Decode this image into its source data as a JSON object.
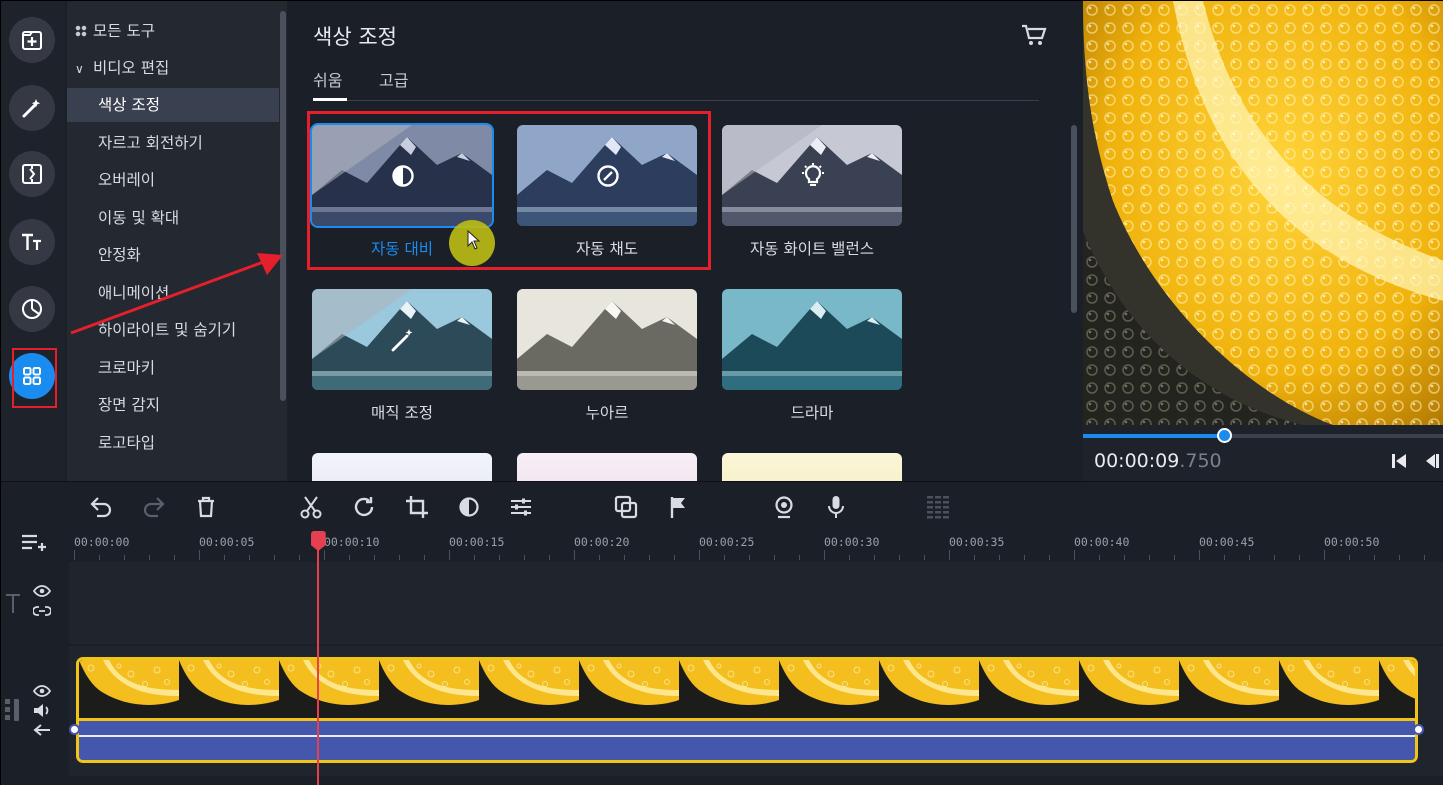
{
  "categories": {
    "all_tools": "모든 도구",
    "video_editing": "비디오 편집",
    "items": [
      "색상 조정",
      "자르고 회전하기",
      "오버레이",
      "이동 및 확대",
      "안정화",
      "애니메이션",
      "하이라이트 및 숨기기",
      "크로마키",
      "장면 감지",
      "로고타입"
    ],
    "selected_index": 0
  },
  "panel": {
    "title": "색상 조정",
    "tabs": [
      "쉬움",
      "고급"
    ],
    "active_tab": 0,
    "tiles": [
      {
        "label": "자동 대비",
        "icon": "contrast-icon",
        "selected": true
      },
      {
        "label": "자동 채도",
        "icon": "gauge-icon",
        "selected": false
      },
      {
        "label": "자동 화이트 밸런스",
        "icon": "lightbulb-icon",
        "selected": false
      },
      {
        "label": "매직 조정",
        "icon": "magic-wand-icon",
        "selected": false
      },
      {
        "label": "누아르",
        "icon": "",
        "selected": false
      },
      {
        "label": "드라마",
        "icon": "",
        "selected": false
      }
    ]
  },
  "preview": {
    "time_main": "00:00:09",
    "time_ms": ".750",
    "progress": 0.39
  },
  "timeline": {
    "ruler_labels": [
      "00:00:00",
      "00:00:05",
      "00:00:10",
      "00:00:15",
      "00:00:20",
      "00:00:25",
      "00:00:30",
      "00:00:35",
      "00:00:40",
      "00:00:45",
      "00:00:50"
    ],
    "playhead_time_seconds": 9.75
  },
  "colors": {
    "accent": "#1a8cf0",
    "highlight_box": "#e5202c",
    "clip_border": "#f2c418",
    "audio_track": "#4556ad",
    "playhead": "#e54050"
  }
}
